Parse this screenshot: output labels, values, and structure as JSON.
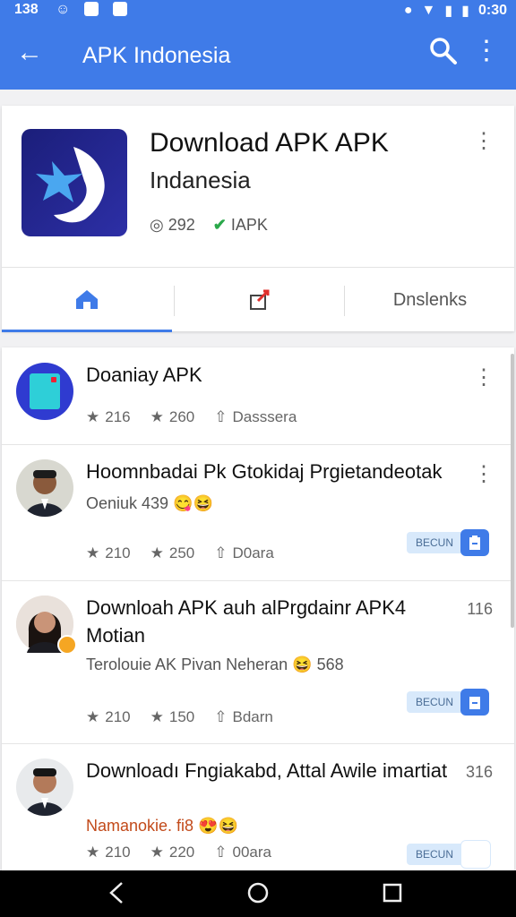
{
  "status_bar": {
    "time_left": "138",
    "time_right": "0:30"
  },
  "app_bar": {
    "title": "APK Indonesia",
    "icons": [
      "back-arrow-icon",
      "search-icon",
      "more-vert-icon"
    ]
  },
  "header_card": {
    "title": "Download APK APK",
    "subtitle": "Indanesia",
    "views": "292",
    "source": "IAPK",
    "tabs": [
      {
        "icon": "home-icon",
        "label": ""
      },
      {
        "icon": "share-box-icon",
        "label": ""
      },
      {
        "icon": "",
        "label": "Dnslenks"
      }
    ]
  },
  "items": [
    {
      "title": "Doaniay APK",
      "subtitle": "",
      "stat1": "216",
      "stat2": "260",
      "stat3": "Dasssera",
      "right_number": "",
      "badge": ""
    },
    {
      "title": "Hoomnbadai Pk Gtokidaj Prgietandeotak",
      "subtitle": "Oeniuk 439",
      "stat1": "210",
      "stat2": "250",
      "stat3": "D0ara",
      "right_number": "",
      "badge": "BECUN"
    },
    {
      "title": "Downloah APK auh alPrgdainr APK4 Motian",
      "subtitle": "Terolouie AK Pivan Neheran",
      "subtitle_num": "568",
      "stat1": "210",
      "stat2": "150",
      "stat3": "Bdarn",
      "right_number": "116",
      "badge": "BECUN"
    },
    {
      "title": "Downloadı Fngiakabd, Attal Awile imartiat",
      "subtitle": "Namanokie. fi8",
      "stat1": "210",
      "stat2": "220",
      "stat3": "00ara",
      "right_number": "316",
      "badge": "BECUN"
    }
  ],
  "colors": {
    "accent": "#3f7be8",
    "badge_bg": "#d8e9fb"
  }
}
